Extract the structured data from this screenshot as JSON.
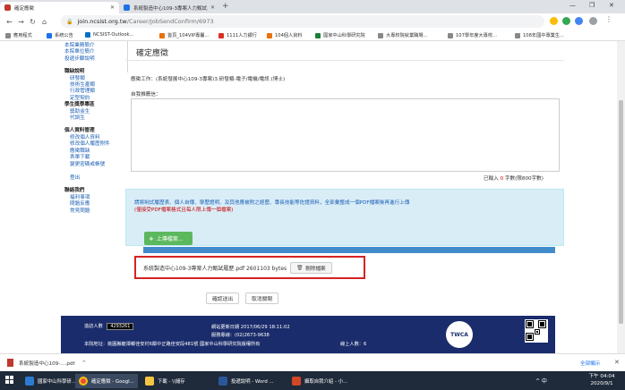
{
  "browser": {
    "tabs": [
      {
        "label": "確定應徵"
      },
      {
        "label": "系統製造中心109-3專案人力甄試..."
      }
    ],
    "new_tab": "+",
    "window_controls": [
      "—",
      "❐",
      "✕"
    ],
    "url_host": "join.ncsist.org.tw",
    "url_path": "/Career/JobSendConfirm/6973"
  },
  "bookmarks": [
    {
      "label": "應用程式",
      "color": "#5f6368"
    },
    {
      "label": "系統公告",
      "color": "#1a73e8"
    },
    {
      "label": "NCSIST-Outlook...",
      "color": "#0072c6"
    },
    {
      "label": "首頁_104VIP專屬...",
      "color": "#e8710a"
    },
    {
      "label": "1111人力銀行",
      "color": "#d93025"
    },
    {
      "label": "104個人資料",
      "color": "#e8710a"
    },
    {
      "label": "國家中山科學研究院",
      "color": "#188038"
    },
    {
      "label": "大專校院就業職場...",
      "color": "#5f6368"
    },
    {
      "label": "107學年度大專校...",
      "color": "#5f6368"
    },
    {
      "label": "108年國中專業生...",
      "color": "#5f6368"
    }
  ],
  "sidebar": {
    "top_links": [
      "本院業務簡介",
      "本院單位簡介",
      "投遞步驟說明"
    ],
    "sections": [
      {
        "head": "職缺說明",
        "items": [
          "研發類",
          "技術生產類",
          "行政管理類",
          "定型契約"
        ]
      },
      {
        "head": "學生獎學專區",
        "items": [
          "獎助金生",
          "代訓生"
        ]
      },
      {
        "head": "個人資料管理",
        "items": [
          "修改個人資料",
          "修改個人履歷附件",
          "應徵職缺",
          "表單下載",
          "變更密碼或帳號"
        ]
      },
      {
        "head": "",
        "items": [
          "登出"
        ]
      },
      {
        "head": "聯絡我們",
        "items": [
          "福利事項",
          "問題反應",
          "常見問題"
        ]
      }
    ]
  },
  "main": {
    "title": "確定應徵",
    "job_line": "應徵工作：(系統發展中心109-3專案)3.研發類-電子/電機/電訊 (博士)",
    "recommend_label": "自我推薦信：",
    "recommend_value": "",
    "counter_prefix": "已輸入",
    "counter_value": "0",
    "counter_suffix": "字數(限800字數)",
    "upload_note": "請將制式履歷表、個人自傳、學歷證明、及其他應被附之經歷、專長技能等佐證資料，全部彙整成一個PDF檔案後再進行上傳",
    "upload_warning": "(僅接受PDF檔案格式且每人限上傳一個檔案)",
    "upload_button": "上傳檔案...",
    "upload_progress": 1.0,
    "file_name": "系統製造中心109-3專案人力甄試履歷.pdf 2601103 bytes",
    "delete_button": "刪除檔案",
    "confirm_button": "確認送出",
    "cancel_button": "取消關閉"
  },
  "footer": {
    "visits_label": "造訪人數",
    "visits_value": "4293261",
    "updated": "網站更新日期 2017/06/29 18:11:02",
    "phone": "服務專線：(02)2673-9638",
    "address": "本院地址：桃園縣龍潭鄉佳安村6鄰中正路佳安段481號 國家中山科學研究院版權所有",
    "online": "線上人數：6",
    "badge": "TWCA"
  },
  "downloads": {
    "file": "系統製造中心109-....pdf",
    "show_all": "全部顯示"
  },
  "taskbar": {
    "items": [
      {
        "label": "國家中山科學研...",
        "icon": "edge"
      },
      {
        "label": "確定應徵 - Googl...",
        "icon": "chrome"
      },
      {
        "label": "下載 - \\\\儲存",
        "icon": "folder"
      },
      {
        "label": "投遞說明 - Word ...",
        "icon": "word"
      },
      {
        "label": "攝取自我介紹 - 小...",
        "icon": "ppt"
      }
    ],
    "tray": "^ 中",
    "time": "下午 04:04",
    "date": "2020/9/1"
  }
}
